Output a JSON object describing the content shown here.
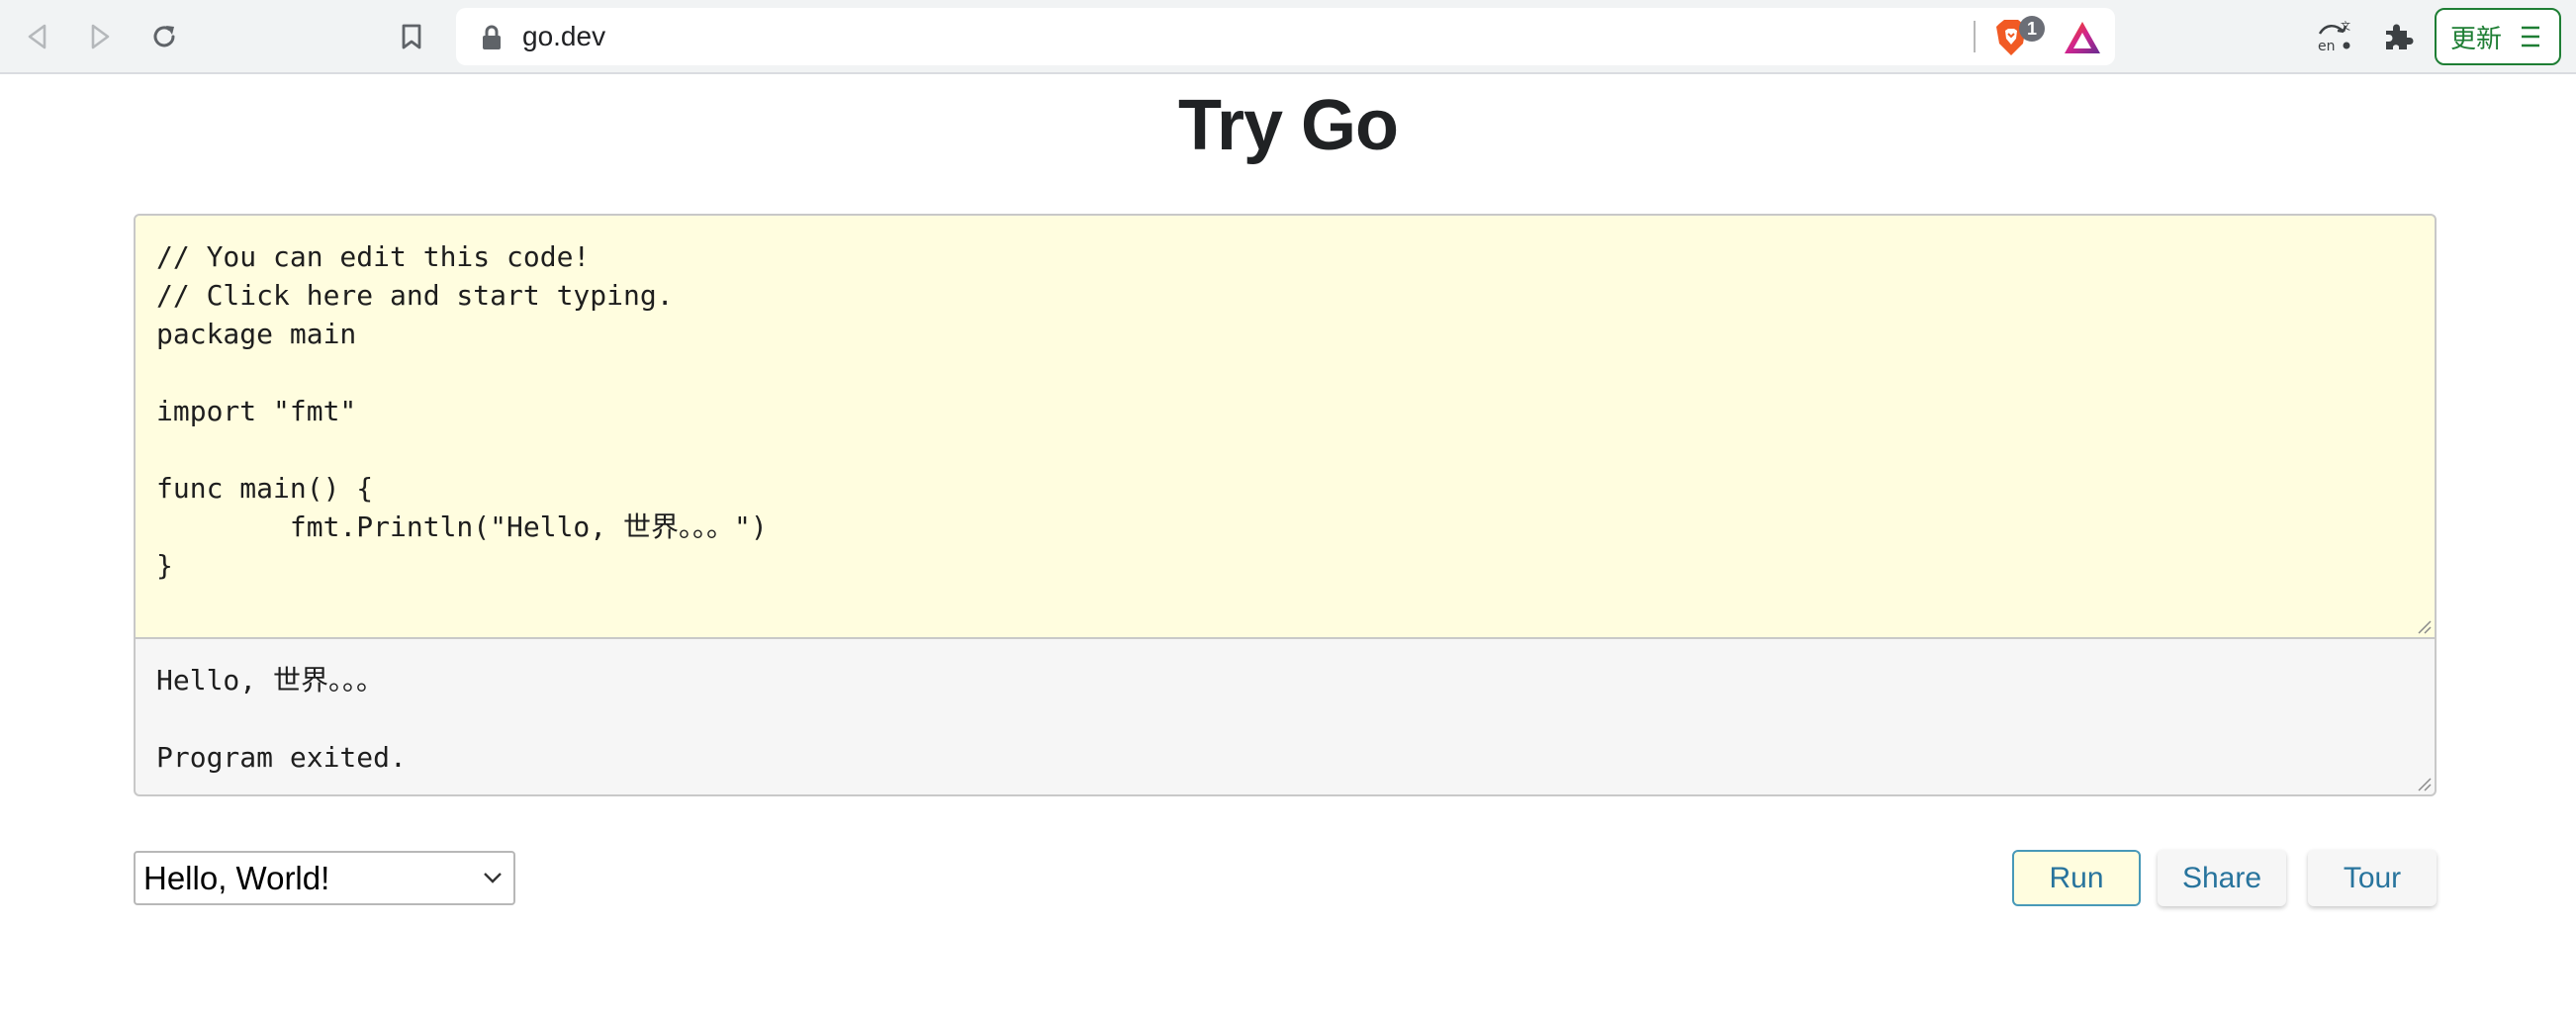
{
  "browser": {
    "url": "go.dev",
    "shield_count": "1",
    "update_label": "更新"
  },
  "page": {
    "title": "Try Go"
  },
  "editor": {
    "code": "// You can edit this code!\n// Click here and start typing.\npackage main\n\nimport \"fmt\"\n\nfunc main() {\n\tfmt.Println(\"Hello, 世界。。。\")\n}"
  },
  "output": {
    "text": "Hello, 世界。。。\n\nProgram exited."
  },
  "controls": {
    "example_selected": "Hello, World!",
    "run_label": "Run",
    "share_label": "Share",
    "tour_label": "Tour"
  },
  "colors": {
    "editor_bg": "#fffddf",
    "output_bg": "#f6f6f6",
    "button_text": "#28749d",
    "update_accent": "#1e7e34"
  }
}
